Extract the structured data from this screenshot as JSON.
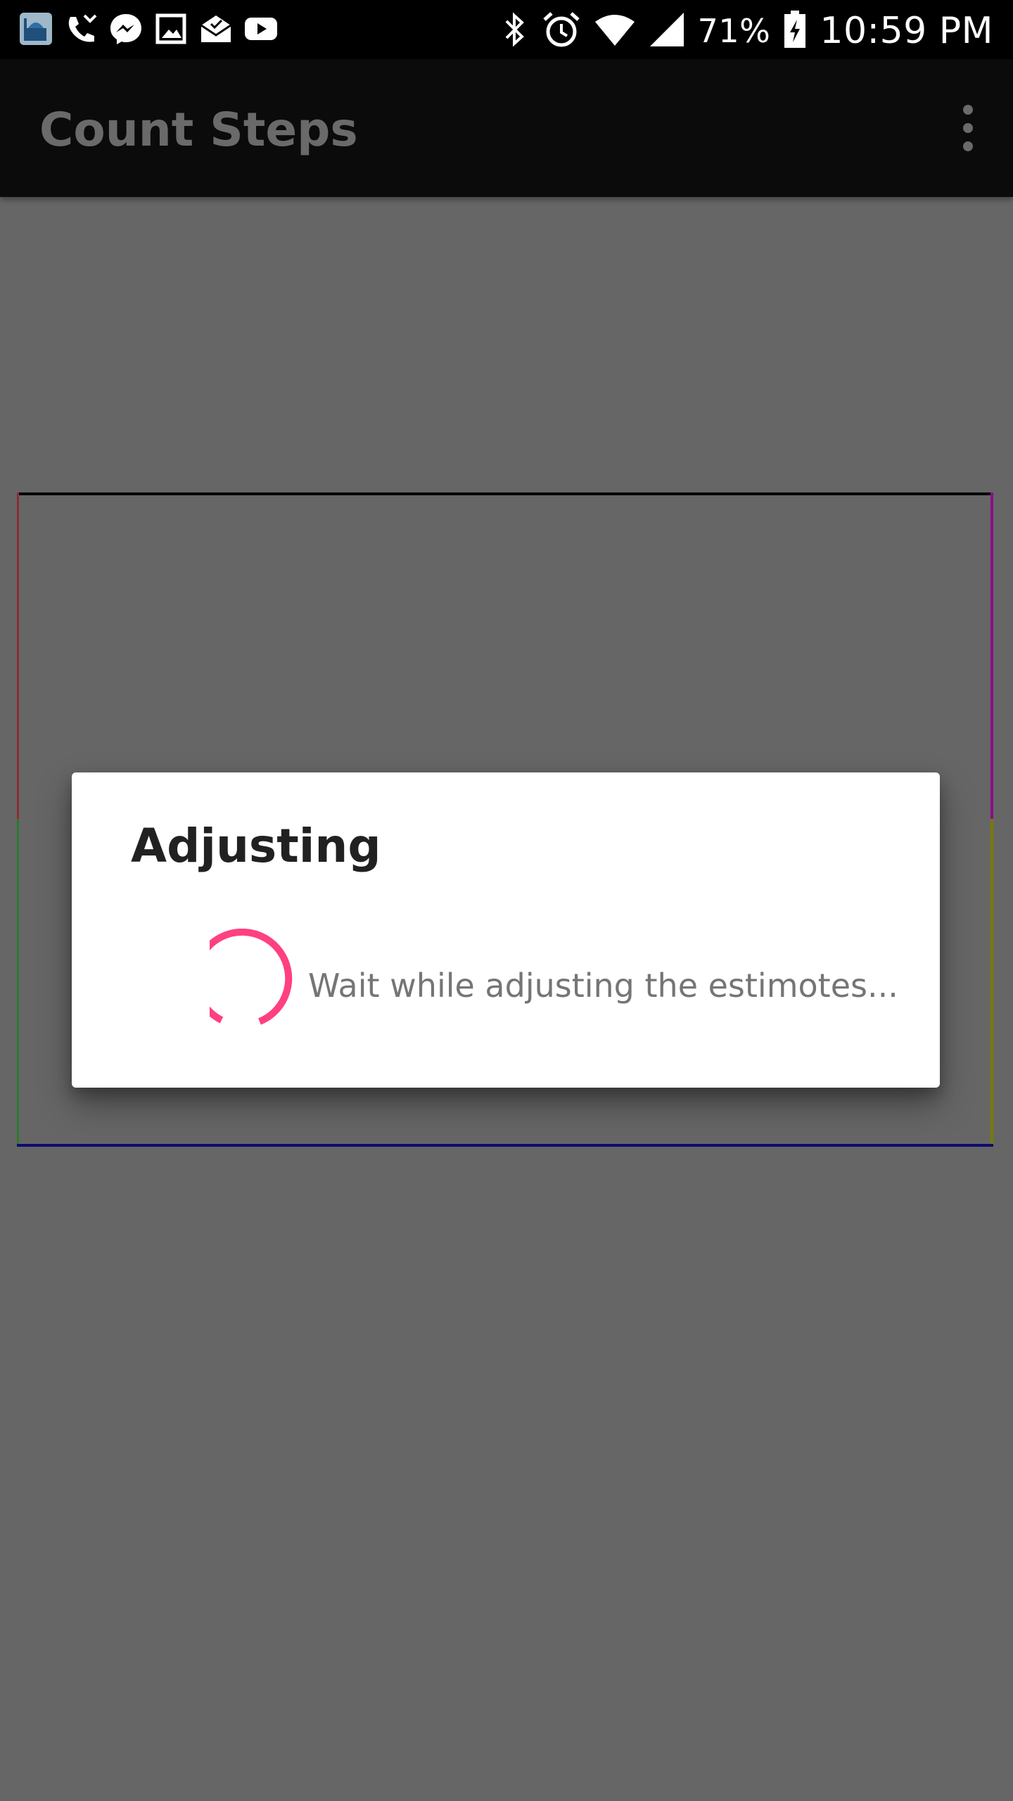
{
  "status_bar": {
    "left_icons": [
      "mosque-app-icon",
      "phone-missed-icon",
      "messenger-icon",
      "image-icon",
      "mail-open-icon",
      "youtube-icon"
    ],
    "right_icons": [
      "bluetooth-icon",
      "alarm-icon",
      "wifi-icon",
      "signal-icon",
      "battery-charging-icon"
    ],
    "battery_percent": "71%",
    "time": "10:59 PM"
  },
  "app_bar": {
    "title": "Count Steps"
  },
  "dialog": {
    "title": "Adjusting",
    "message": "Wait while adjusting the estimotes..."
  },
  "colors": {
    "accent": "#ff4081",
    "scrim": "#666666",
    "app_bar": "#0b0b0b"
  }
}
